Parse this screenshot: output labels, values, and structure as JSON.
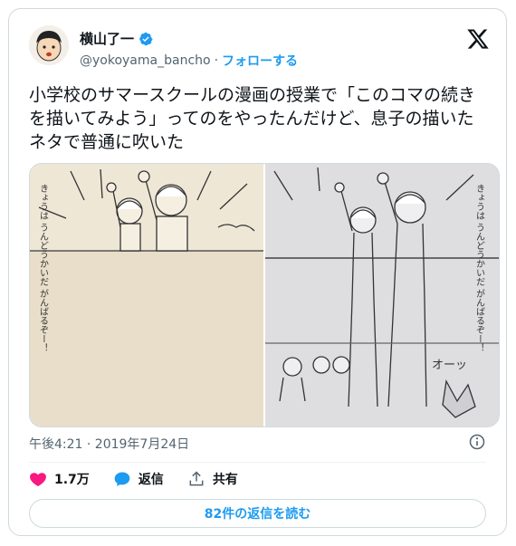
{
  "author": {
    "name": "横山了一",
    "handle": "@yokoyama_bancho",
    "separator": "·",
    "follow_label": "フォローする"
  },
  "tweet": {
    "text": "小学校のサマースクールの漫画の授業で「このコマの続きを描いてみよう」ってのをやったんだけど、息子の描いたネタで普通に吹いた",
    "timestamp": "午後4:21 · 2019年7月24日"
  },
  "media": {
    "left_caption": "きょうは うんどうかいだ がんばるぞー！",
    "right_caption": "きょうは うんどうかいだ がんばるぞー！",
    "right_sfx": "オーッ"
  },
  "actions": {
    "like_count": "1.7万",
    "reply_label": "返信",
    "share_label": "共有"
  },
  "replies_button_label": "82件の返信を読む",
  "colors": {
    "accent": "#1d9bf0",
    "like": "#f91880",
    "text": "#0f1419",
    "muted": "#536471"
  }
}
